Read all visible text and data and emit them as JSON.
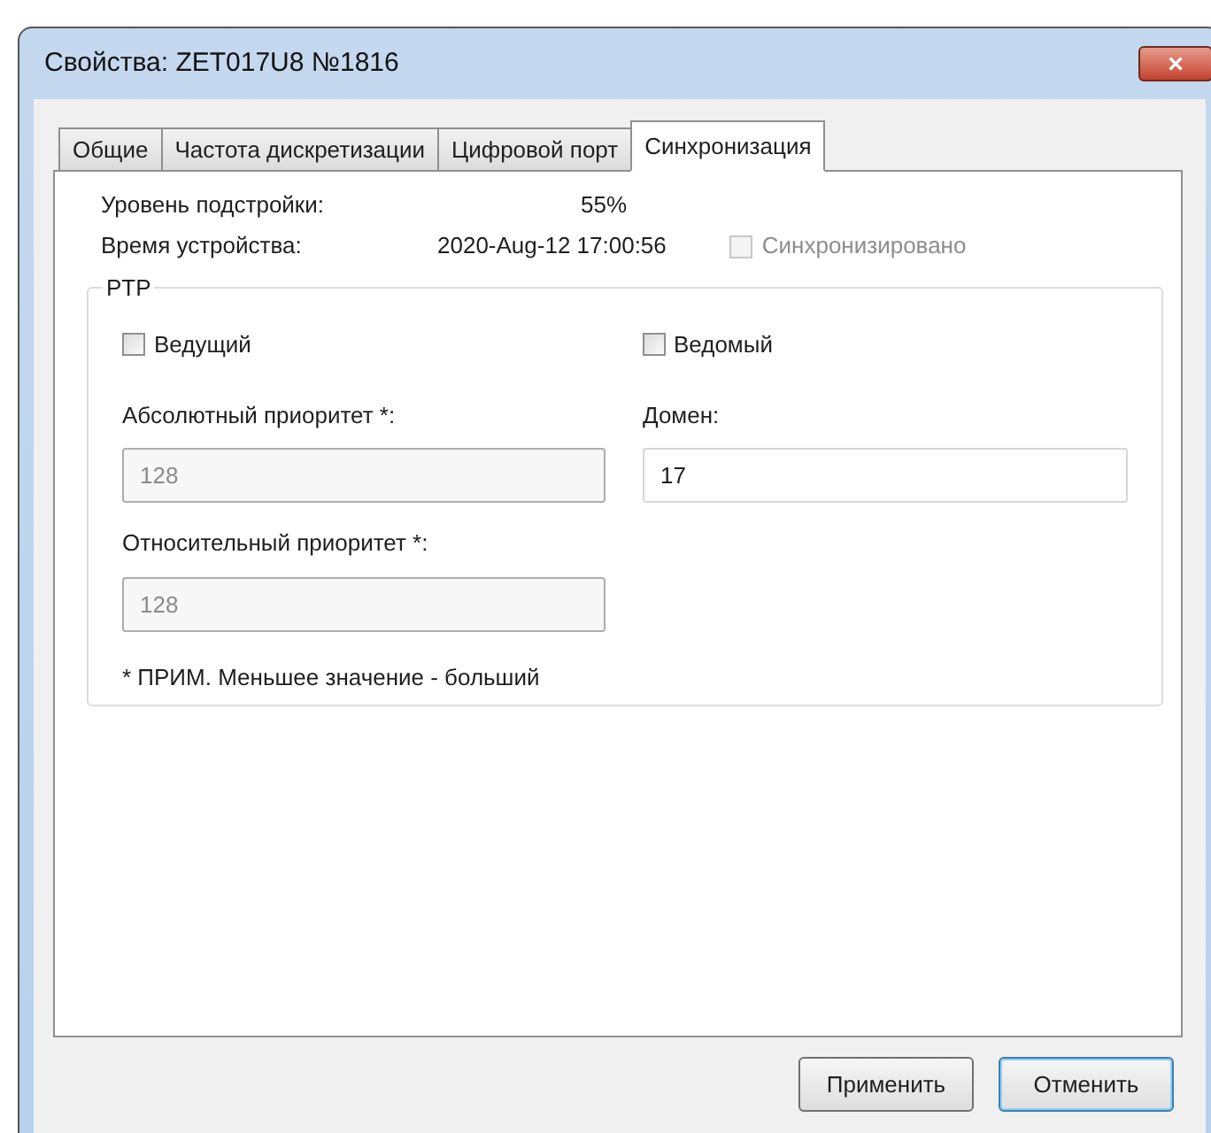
{
  "window": {
    "title": "Свойства: ZET017U8 №1816",
    "close": "×"
  },
  "tabs": [
    {
      "label": "Общие",
      "selected": false
    },
    {
      "label": "Частота дискретизации",
      "selected": false
    },
    {
      "label": "Цифровой порт",
      "selected": false
    },
    {
      "label": "Синхронизация",
      "selected": true
    }
  ],
  "info": [
    {
      "label": "Уровень подстройки:",
      "value": "55%"
    },
    {
      "label": "Время устройства:",
      "value": "2020-Aug-12 17:00:56"
    }
  ],
  "synchronized": {
    "label": "Синхронизировано",
    "checked": false,
    "disabled": true
  },
  "ptp": {
    "title": "PTP",
    "roles": [
      {
        "label": "Ведущий",
        "checked": false
      },
      {
        "label": "Ведомый",
        "checked": false
      }
    ],
    "absolute_priority": {
      "label": "Абсолютный приоритет *:",
      "value": "128",
      "disabled": true
    },
    "domain": {
      "label": "Домен:",
      "value": "17",
      "disabled": false
    },
    "relative_priority": {
      "label": "Относительный приоритет *:",
      "value": "128",
      "disabled": true
    },
    "note": "* ПРИМ. Меньшее значение - больший"
  },
  "buttons": [
    {
      "label": "Применить",
      "default": false
    },
    {
      "label": "Отменить",
      "default": true
    }
  ]
}
